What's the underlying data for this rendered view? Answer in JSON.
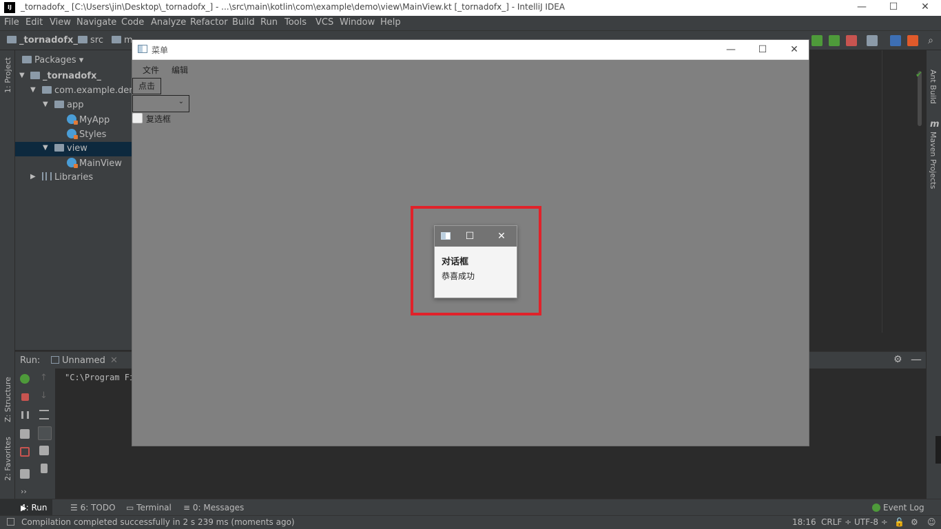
{
  "ide": {
    "title": "_tornadofx_ [C:\\Users\\jin\\Desktop\\_tornadofx_] - ...\\src\\main\\kotlin\\com\\example\\demo\\view\\MainView.kt [_tornadofx_] - IntelliJ IDEA",
    "logo": "IJ",
    "window_controls": {
      "minimize": "—",
      "maximize": "☐",
      "close": "✕"
    }
  },
  "menubar": [
    "File",
    "Edit",
    "View",
    "Navigate",
    "Code",
    "Analyze",
    "Refactor",
    "Build",
    "Run",
    "Tools",
    "VCS",
    "Window",
    "Help"
  ],
  "navbar": {
    "crumbs": [
      "_tornadofx_",
      "src",
      "m"
    ]
  },
  "left_tabs": {
    "project": "1: Project",
    "structure": "Z: Structure",
    "favorites": "2: Favorites"
  },
  "right_tabs": {
    "ant": "Ant Build",
    "maven": "Maven Projects",
    "maven_icon": "m"
  },
  "project_panel": {
    "header": "Packages ▾",
    "tree": [
      {
        "label": "_tornadofx_",
        "icon": "module-folder-icon"
      },
      {
        "label": "com.example.demo",
        "icon": "package-folder-icon"
      },
      {
        "label": "app",
        "icon": "package-folder-icon"
      },
      {
        "label": "MyApp",
        "icon": "kotlin-class-icon"
      },
      {
        "label": "Styles",
        "icon": "kotlin-class-icon"
      },
      {
        "label": "view",
        "icon": "package-folder-icon"
      },
      {
        "label": "MainView",
        "icon": "kotlin-class-icon"
      },
      {
        "label": "Libraries",
        "icon": "libraries-icon"
      }
    ]
  },
  "run_panel": {
    "label": "Run:",
    "tab": "Unnamed",
    "console_line": "\"C:\\Program Fi"
  },
  "tool_buttons": {
    "run": "4: Run",
    "todo": "6: TODO",
    "terminal": "Terminal",
    "messages": "0: Messages",
    "event_log": "Event Log"
  },
  "status": {
    "message": "Compilation completed successfully in 2 s 239 ms (moments ago)",
    "position": "18:16",
    "line_sep": "CRLF ÷",
    "encoding": "UTF-8 ÷"
  },
  "app": {
    "title": "菜单",
    "menus": [
      "文件",
      "编辑"
    ],
    "button_label": "点击",
    "combo_caret": "⌄",
    "checkbox_label": "复选框",
    "controls": {
      "minimize": "—",
      "maximize": "☐",
      "close": "✕"
    }
  },
  "dialog": {
    "header": "对话框",
    "content": "恭喜成功",
    "controls": {
      "maximize": "☐",
      "close": "✕"
    },
    "highlight_color": "#e0222a"
  }
}
